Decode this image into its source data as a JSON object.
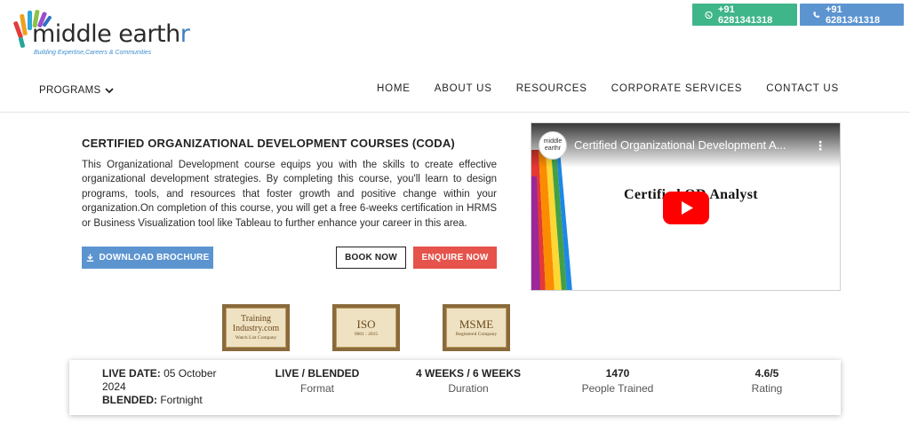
{
  "logo": {
    "name_main": "middle earth",
    "name_accent": "r",
    "tagline": "Building Expertise,Careers & Communities"
  },
  "contact": {
    "whatsapp": "+91 6281341318",
    "phone": "+91 6281341318"
  },
  "nav": {
    "programs": "PROGRAMS",
    "items": [
      "HOME",
      "ABOUT US",
      "RESOURCES",
      "CORPORATE SERVICES",
      "CONTACT US"
    ]
  },
  "course": {
    "title": "CERTIFIED ORGANIZATIONAL DEVELOPMENT COURSES (CODA)",
    "description": "This Organizational Development course equips you with the skills to create effective organizational development strategies. By completing this course, you'll learn to design programs, tools, and resources that foster growth and positive change within your organization.On completion of this course, you will get a free 6-weeks certification in HRMS or Business Visualization tool like Tableau to further enhance your career in this area.",
    "download_label": "DOWNLOAD BROCHURE",
    "book_label": "BOOK NOW",
    "enquire_label": "ENQUIRE NOW"
  },
  "video": {
    "title": "Certified Organizational Development A...",
    "slide_text": "Certified OD Analyst",
    "channel_logo": "middle earthr"
  },
  "badges": [
    {
      "main": "Training Industry.com",
      "sub": "Watch List Company"
    },
    {
      "main": "ISO",
      "sub": "9001 : 2015"
    },
    {
      "main": "MSME",
      "sub": "Registered Company"
    }
  ],
  "info": {
    "live_date_label": "LIVE DATE:",
    "live_date_value": "05 October 2024",
    "blended_label": "BLENDED:",
    "blended_value": "Fortnight",
    "stats": [
      {
        "value": "LIVE / BLENDED",
        "label": "Format"
      },
      {
        "value": "4 WEEKS / 6 WEEKS",
        "label": "Duration"
      },
      {
        "value": "1470",
        "label": "People Trained"
      },
      {
        "value": "4.6/5",
        "label": "Rating"
      }
    ]
  },
  "colors": {
    "whatsapp_green": "#3fb58a",
    "primary_blue": "#5c94d0",
    "enquire_red": "#e5534b",
    "youtube_red": "#ff0000"
  }
}
